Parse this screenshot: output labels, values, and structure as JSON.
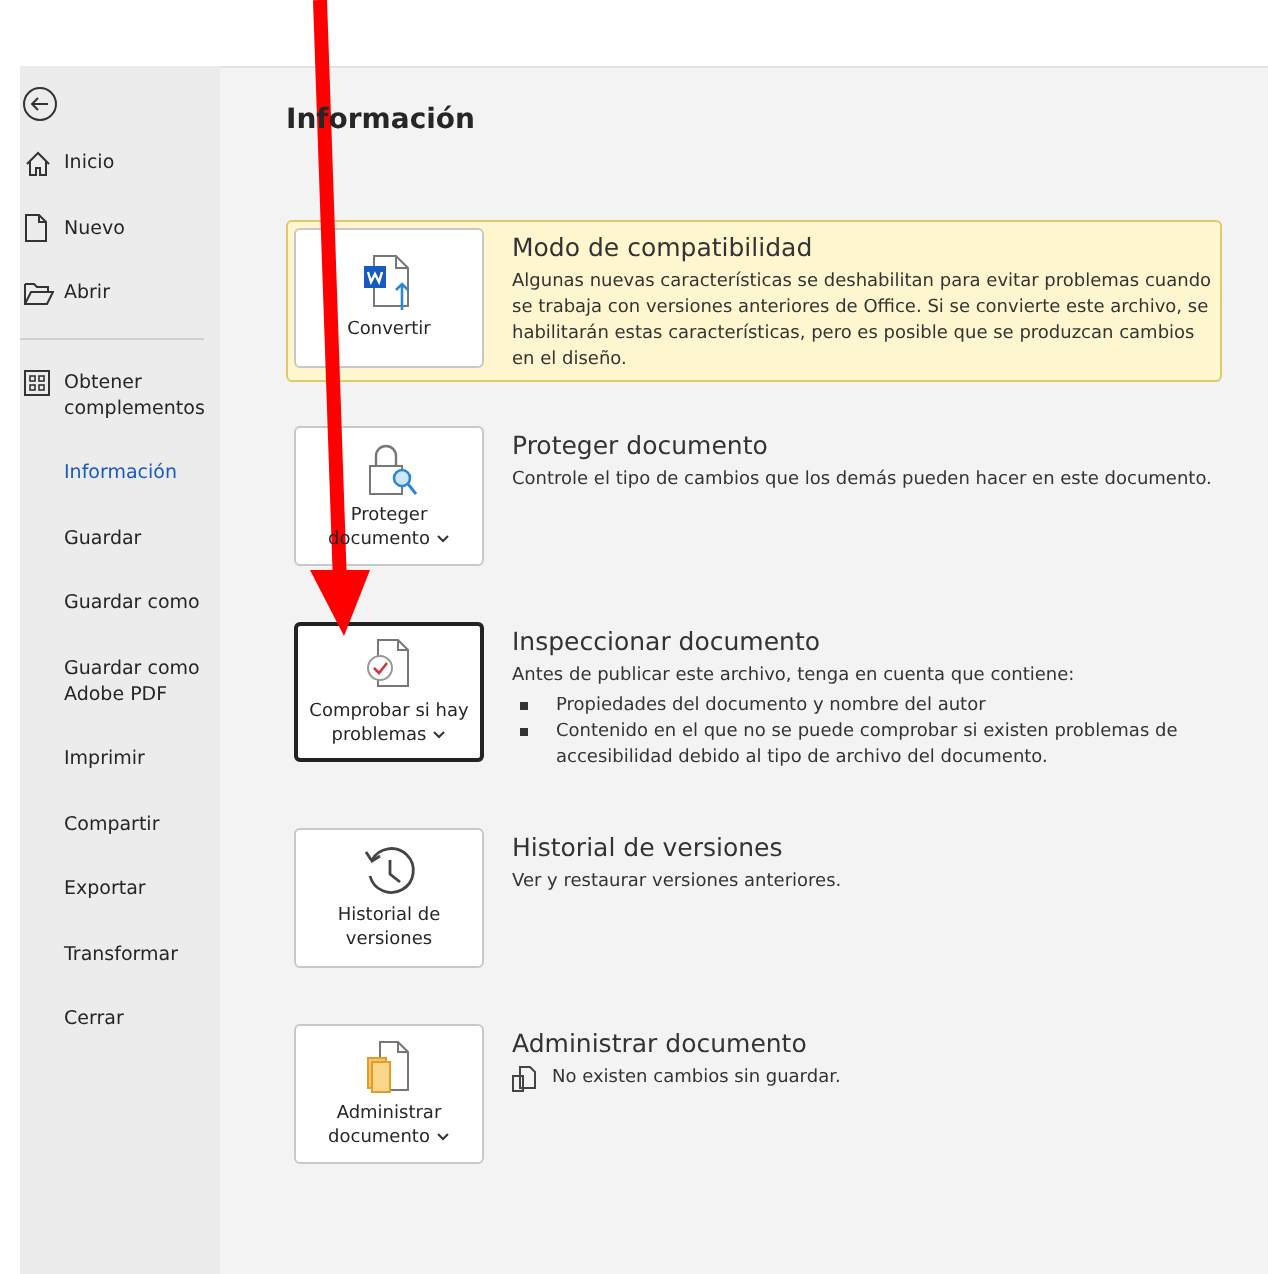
{
  "sidebar": {
    "items": [
      {
        "label": "Inicio",
        "selected": false
      },
      {
        "label": "Nuevo",
        "selected": false
      },
      {
        "label": "Abrir",
        "selected": false
      },
      {
        "label": "Obtener complementos",
        "selected": false
      },
      {
        "label": "Información",
        "selected": true
      },
      {
        "label": "Guardar",
        "selected": false
      },
      {
        "label": "Guardar como",
        "selected": false
      },
      {
        "label": "Guardar como Adobe PDF",
        "selected": false
      },
      {
        "label": "Imprimir",
        "selected": false
      },
      {
        "label": "Compartir",
        "selected": false
      },
      {
        "label": "Exportar",
        "selected": false
      },
      {
        "label": "Transformar",
        "selected": false
      },
      {
        "label": "Cerrar",
        "selected": false
      }
    ]
  },
  "page_title": "Información",
  "sections": [
    {
      "button": {
        "label": "Convertir",
        "dropdown": false,
        "focused": false
      },
      "highlight": true,
      "heading": "Modo de compatibilidad",
      "text": "Algunas nuevas características se deshabilitan para evitar problemas cuando se trabaja con versiones anteriores de Office. Si se convierte este archivo, se habilitarán estas características, pero es posible que se produzcan cambios en el diseño."
    },
    {
      "button": {
        "label": "Proteger documento",
        "dropdown": true,
        "focused": false
      },
      "highlight": false,
      "heading": "Proteger documento",
      "text": "Controle el tipo de cambios que los demás pueden hacer en este documento."
    },
    {
      "button": {
        "label": "Comprobar si hay problemas",
        "dropdown": true,
        "focused": true
      },
      "highlight": false,
      "heading": "Inspeccionar documento",
      "text": "Antes de publicar este archivo, tenga en cuenta que contiene:",
      "bullets": [
        "Propiedades del documento y nombre del autor",
        "Contenido en el que no se puede comprobar si existen problemas de accesibilidad debido al tipo de archivo del documento."
      ]
    },
    {
      "button": {
        "label": "Historial de versiones",
        "dropdown": false,
        "focused": false
      },
      "highlight": false,
      "heading": "Historial de versiones",
      "text": "Ver y restaurar versiones anteriores."
    },
    {
      "button": {
        "label": "Administrar documento",
        "dropdown": true,
        "focused": false
      },
      "highlight": false,
      "heading": "Administrar documento",
      "text": "No existen cambios sin guardar."
    }
  ],
  "annotation": {
    "kind": "arrow"
  }
}
